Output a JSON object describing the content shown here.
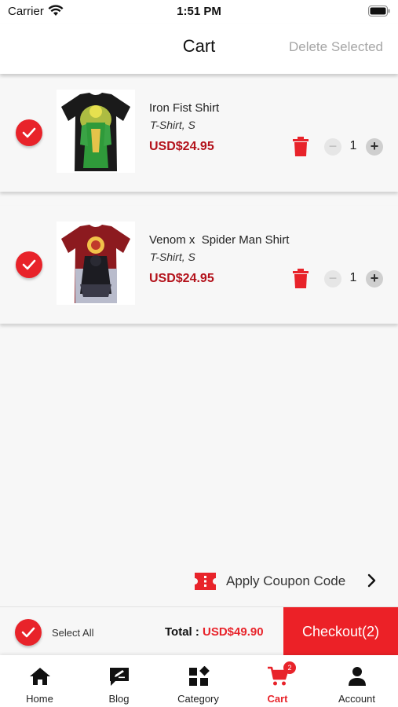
{
  "status_bar": {
    "carrier": "Carrier",
    "time": "1:51 PM"
  },
  "header": {
    "title": "Cart",
    "delete_selected": "Delete Selected"
  },
  "items": [
    {
      "name": "Iron Fist Shirt",
      "variant": "T-Shirt, S",
      "price": "USD$24.95",
      "quantity": "1",
      "selected": true
    },
    {
      "name": "Venom x  Spider Man Shirt",
      "variant": "T-Shirt, S",
      "price": "USD$24.95",
      "quantity": "1",
      "selected": true
    }
  ],
  "qty_controls": {
    "minus": "−",
    "plus": "+"
  },
  "coupon": {
    "label": "Apply Coupon Code"
  },
  "checkout_bar": {
    "select_all": "Select All",
    "total_label": "Total :",
    "total_value": "USD$49.90",
    "checkout_button": "Checkout(2)"
  },
  "tabs": [
    {
      "label": "Home",
      "icon": "home-icon"
    },
    {
      "label": "Blog",
      "icon": "blog-icon"
    },
    {
      "label": "Category",
      "icon": "category-icon"
    },
    {
      "label": "Cart",
      "icon": "cart-icon",
      "active": true,
      "badge": "2"
    },
    {
      "label": "Account",
      "icon": "account-icon"
    }
  ],
  "colors": {
    "accent": "#e8232a",
    "price": "#b3121b",
    "muted": "#a6a6a6"
  }
}
